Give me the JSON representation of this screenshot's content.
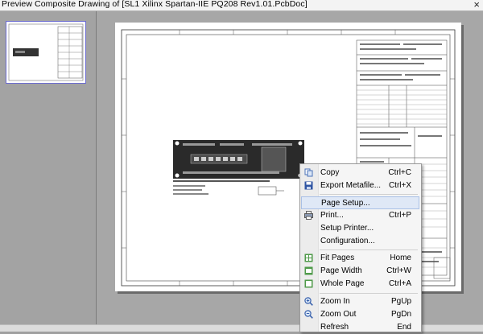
{
  "window": {
    "title": "Preview Composite Drawing of [SL1 Xilinx Spartan-IIE PQ208 Rev1.01.PcbDoc]",
    "close_glyph": "×"
  },
  "context_menu": {
    "items": [
      {
        "label": "Copy",
        "shortcut": "Ctrl+C",
        "icon": "copy-icon"
      },
      {
        "label": "Export Metafile...",
        "shortcut": "Ctrl+X",
        "icon": "save-icon"
      },
      {
        "label": "Page Setup...",
        "shortcut": "",
        "icon": ""
      },
      {
        "label": "Print...",
        "shortcut": "Ctrl+P",
        "icon": "printer-icon"
      },
      {
        "label": "Setup Printer...",
        "shortcut": "",
        "icon": ""
      },
      {
        "label": "Configuration...",
        "shortcut": "",
        "icon": ""
      },
      {
        "label": "Fit Pages",
        "shortcut": "Home",
        "icon": "fit-pages-icon"
      },
      {
        "label": "Page Width",
        "shortcut": "Ctrl+W",
        "icon": "page-width-icon"
      },
      {
        "label": "Whole Page",
        "shortcut": "Ctrl+A",
        "icon": "whole-page-icon"
      },
      {
        "label": "Zoom In",
        "shortcut": "PgUp",
        "icon": "zoom-in-icon"
      },
      {
        "label": "Zoom Out",
        "shortcut": "PgDn",
        "icon": "zoom-out-icon"
      },
      {
        "label": "Refresh",
        "shortcut": "End",
        "icon": ""
      }
    ]
  },
  "colors": {
    "accent_highlight": "#dfe8f6",
    "pcb_board": "#2a2a2a",
    "background": "#a7a7a7"
  }
}
